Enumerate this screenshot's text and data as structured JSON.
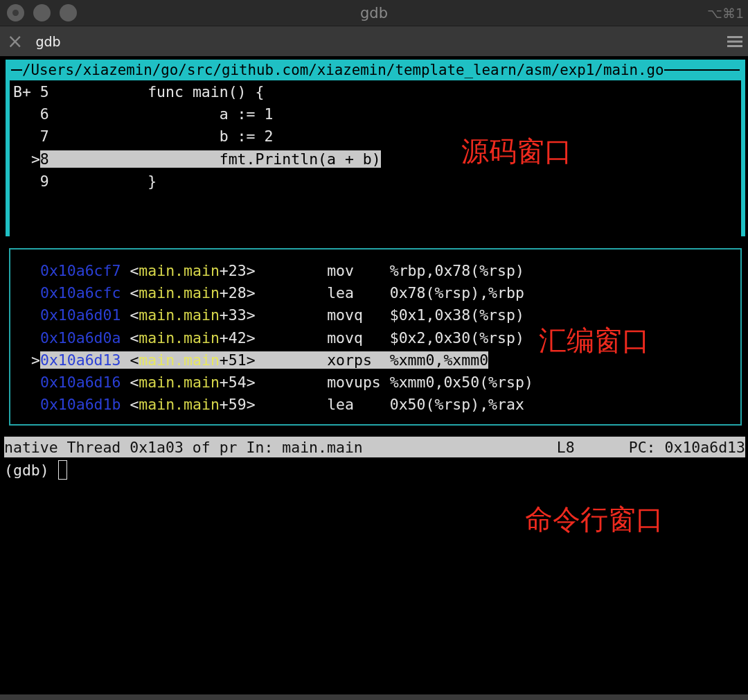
{
  "window": {
    "title": "gdb",
    "shortcut": "⌥⌘1"
  },
  "tabs": [
    {
      "label": "gdb",
      "close": "×",
      "selected": true
    }
  ],
  "source_window": {
    "title": "/Users/xiazemin/go/src/github.com/xiazemin/template_learn/asm/exp1/main.go",
    "lines": [
      {
        "marker": "B+",
        "number": "5",
        "code": "func main() {",
        "selected": false
      },
      {
        "number": "6",
        "code": "        a := 1",
        "selected": false
      },
      {
        "number": "7",
        "code": "        b := 2",
        "selected": false
      },
      {
        "marker": ">",
        "number": "8",
        "code": "        fmt.Println(a + b)",
        "selected": true
      },
      {
        "number": "9",
        "code": "}",
        "selected": false
      }
    ]
  },
  "asm_window": {
    "rows": [
      {
        "address": "0x10a6cf7",
        "open": "<",
        "symbol": "main.main",
        "offset": "+23>",
        "mnemonic": "mov",
        "operands": "%rbp,0x78(%rsp)",
        "selected": false
      },
      {
        "address": "0x10a6cfc",
        "open": "<",
        "symbol": "main.main",
        "offset": "+28>",
        "mnemonic": "lea",
        "operands": "0x78(%rsp),%rbp",
        "selected": false
      },
      {
        "address": "0x10a6d01",
        "open": "<",
        "symbol": "main.main",
        "offset": "+33>",
        "mnemonic": "movq",
        "operands": "$0x1,0x38(%rsp)",
        "selected": false
      },
      {
        "address": "0x10a6d0a",
        "open": "<",
        "symbol": "main.main",
        "offset": "+42>",
        "mnemonic": "movq",
        "operands": "$0x2,0x30(%rsp)",
        "selected": false
      },
      {
        "marker": ">",
        "address": "0x10a6d13",
        "open": "<",
        "symbol": "main.main",
        "offset": "+51>",
        "mnemonic": "xorps",
        "operands": "%xmm0,%xmm0",
        "selected": true
      },
      {
        "address": "0x10a6d16",
        "open": "<",
        "symbol": "main.main",
        "offset": "+54>",
        "mnemonic": "movups",
        "operands": "%xmm0,0x50(%rsp)",
        "selected": false
      },
      {
        "address": "0x10a6d1b",
        "open": "<",
        "symbol": "main.main",
        "offset": "+59>",
        "mnemonic": "lea",
        "operands": "0x50(%rsp),%rax",
        "selected": false
      }
    ]
  },
  "status_bar": {
    "thread": "native Thread 0x1a03 of pr In: main.main",
    "line": "L8",
    "pc": "PC: 0x10a6d13"
  },
  "command_window": {
    "prompt": "(gdb)"
  },
  "annotations": [
    {
      "text": "源码窗口",
      "kind": "source"
    },
    {
      "text": "汇编窗口",
      "kind": "asm"
    },
    {
      "text": "命令行窗口",
      "kind": "command"
    }
  ]
}
